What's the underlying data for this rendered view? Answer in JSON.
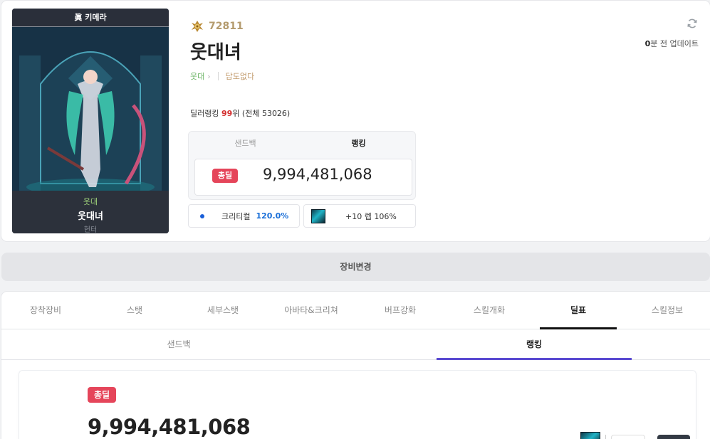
{
  "character": {
    "server": "眞 키메라",
    "adventure": "웃대",
    "name": "웃대녀",
    "job": "헌터",
    "fame": "72811",
    "guild": "답도없다"
  },
  "update": {
    "minutes": "0",
    "text": "분 전 업데이트"
  },
  "dealer_rank": {
    "label": "딜러랭킹",
    "rank": "99",
    "suffix": "위 (전체 53026)"
  },
  "damage_box": {
    "tabs": [
      "샌드백",
      "랭킹"
    ],
    "active_tab": "랭킹",
    "badge": "총딜",
    "total": "9,994,481,068"
  },
  "crit": {
    "label": "크리티컬",
    "value": "120.0%"
  },
  "weapon": {
    "label": "+10 렙 106%"
  },
  "equip_change": "장비변경",
  "main_tabs": [
    "장착장비",
    "스탯",
    "세부스탯",
    "아바타&크리쳐",
    "버프강화",
    "스킬개화",
    "딜표",
    "스킬정보"
  ],
  "active_main_tab": "딜표",
  "sub_tabs": [
    "샌드백",
    "랭킹"
  ],
  "active_sub_tab": "랭킹",
  "result": {
    "badge": "총딜",
    "total": "9,994,481,068"
  },
  "colors": {
    "accent": "#e5455a",
    "sub_tab_indicator": "#5a4ad1",
    "crit": "#1a6fd8",
    "rank": "#d32f2f"
  },
  "icons": {
    "fame": "fame-medal-icon",
    "refresh": "refresh-icon",
    "weapon": "weapon-thumbnail"
  }
}
